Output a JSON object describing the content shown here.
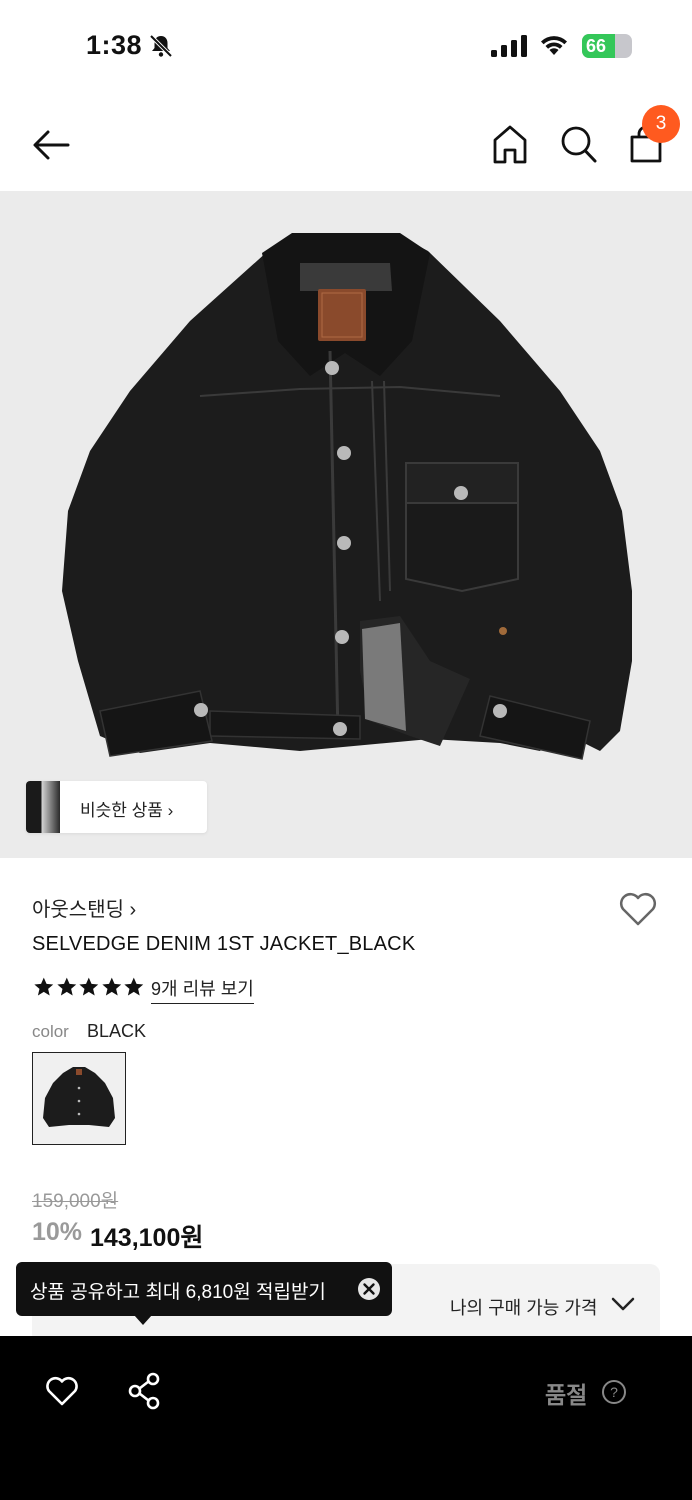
{
  "status_bar": {
    "time": "1:38",
    "battery_text": "66",
    "battery_level_percent": 66
  },
  "nav": {
    "cart_count": "3"
  },
  "hero": {
    "similar_label": "비슷한 상품 ›"
  },
  "product": {
    "brand": "아웃스탠딩 ›",
    "name": "SELVEDGE DENIM 1ST JACKET_BLACK",
    "rating_stars": 5,
    "review_link": "9개 리뷰 보기",
    "color_label": "color",
    "color_value": "BLACK",
    "original_price": "159,000원",
    "discount": "10%",
    "sale_price": "143,100원",
    "my_price_label": "나의 구매 가능 가격"
  },
  "tooltip": {
    "text": "상품 공유하고 최대 6,810원 적립받기"
  },
  "bottom_bar": {
    "soldout_label": "품절"
  },
  "colors": {
    "badge": "#ff5a1f",
    "battery": "#34c759",
    "bottom_bar_bg": "#000000"
  }
}
